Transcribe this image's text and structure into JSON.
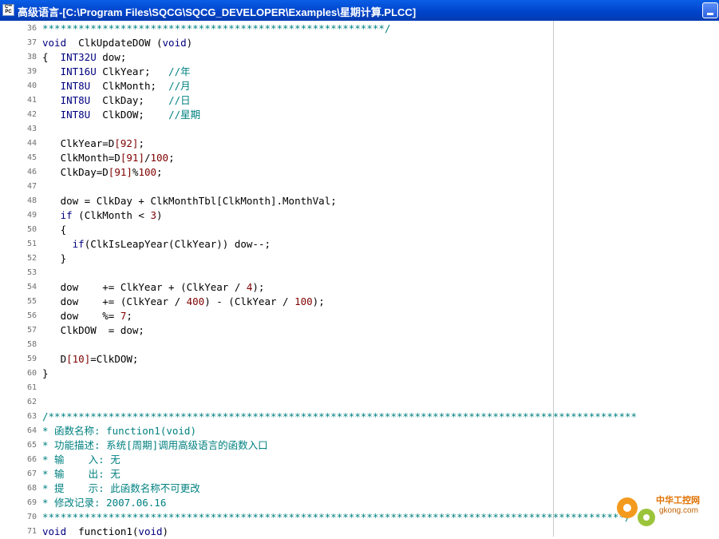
{
  "window": {
    "title": "高级语言-[C:\\Program Files\\SQCG\\SQCG_DEVELOPER\\Examples\\星期计算.PLCC]",
    "icon_label": "C**\nPC"
  },
  "editor": {
    "lines": [
      {
        "n": "36",
        "t": "*********************************************************/"
      },
      {
        "n": "37",
        "t": "void  ClkUpdateDOW (void)"
      },
      {
        "n": "38",
        "t": "{  INT32U dow;"
      },
      {
        "n": "39",
        "t": "   INT16U ClkYear;   //年"
      },
      {
        "n": "40",
        "t": "   INT8U  ClkMonth;  //月"
      },
      {
        "n": "41",
        "t": "   INT8U  ClkDay;    //日"
      },
      {
        "n": "42",
        "t": "   INT8U  ClkDOW;    //星期"
      },
      {
        "n": "43",
        "t": ""
      },
      {
        "n": "44",
        "t": "   ClkYear=D[92];"
      },
      {
        "n": "45",
        "t": "   ClkMonth=D[91]/100;"
      },
      {
        "n": "46",
        "t": "   ClkDay=D[91]%100;"
      },
      {
        "n": "47",
        "t": ""
      },
      {
        "n": "48",
        "t": "   dow = ClkDay + ClkMonthTbl[ClkMonth].MonthVal;"
      },
      {
        "n": "49",
        "t": "   if (ClkMonth < 3)"
      },
      {
        "n": "50",
        "t": "   {"
      },
      {
        "n": "51",
        "t": "     if(ClkIsLeapYear(ClkYear)) dow--;"
      },
      {
        "n": "52",
        "t": "   }"
      },
      {
        "n": "53",
        "t": ""
      },
      {
        "n": "54",
        "t": "   dow    += ClkYear + (ClkYear / 4);"
      },
      {
        "n": "55",
        "t": "   dow    += (ClkYear / 400) - (ClkYear / 100);"
      },
      {
        "n": "56",
        "t": "   dow    %= 7;"
      },
      {
        "n": "57",
        "t": "   ClkDOW  = dow;"
      },
      {
        "n": "58",
        "t": ""
      },
      {
        "n": "59",
        "t": "   D[10]=ClkDOW;"
      },
      {
        "n": "60",
        "t": "}"
      },
      {
        "n": "61",
        "t": ""
      },
      {
        "n": "62",
        "t": ""
      },
      {
        "n": "63",
        "t": "/**************************************************************************************************"
      },
      {
        "n": "64",
        "t": "* 函数名称: function1(void)"
      },
      {
        "n": "65",
        "t": "* 功能描述: 系统[周期]调用高级语言的函数入口"
      },
      {
        "n": "66",
        "t": "* 输    入: 无"
      },
      {
        "n": "67",
        "t": "* 输    出: 无"
      },
      {
        "n": "68",
        "t": "* 提    示: 此函数名称不可更改"
      },
      {
        "n": "69",
        "t": "* 修改记录: 2007.06.16"
      },
      {
        "n": "70",
        "t": "*************************************************************************************************/"
      },
      {
        "n": "71",
        "t": "void  function1(void)"
      }
    ]
  },
  "watermark": {
    "text": "中华工控网",
    "url": "gkong.com"
  },
  "colors": {
    "titlebar": "#0044cc",
    "keyword": "#000080",
    "number": "#800000",
    "comment": "#008080"
  }
}
